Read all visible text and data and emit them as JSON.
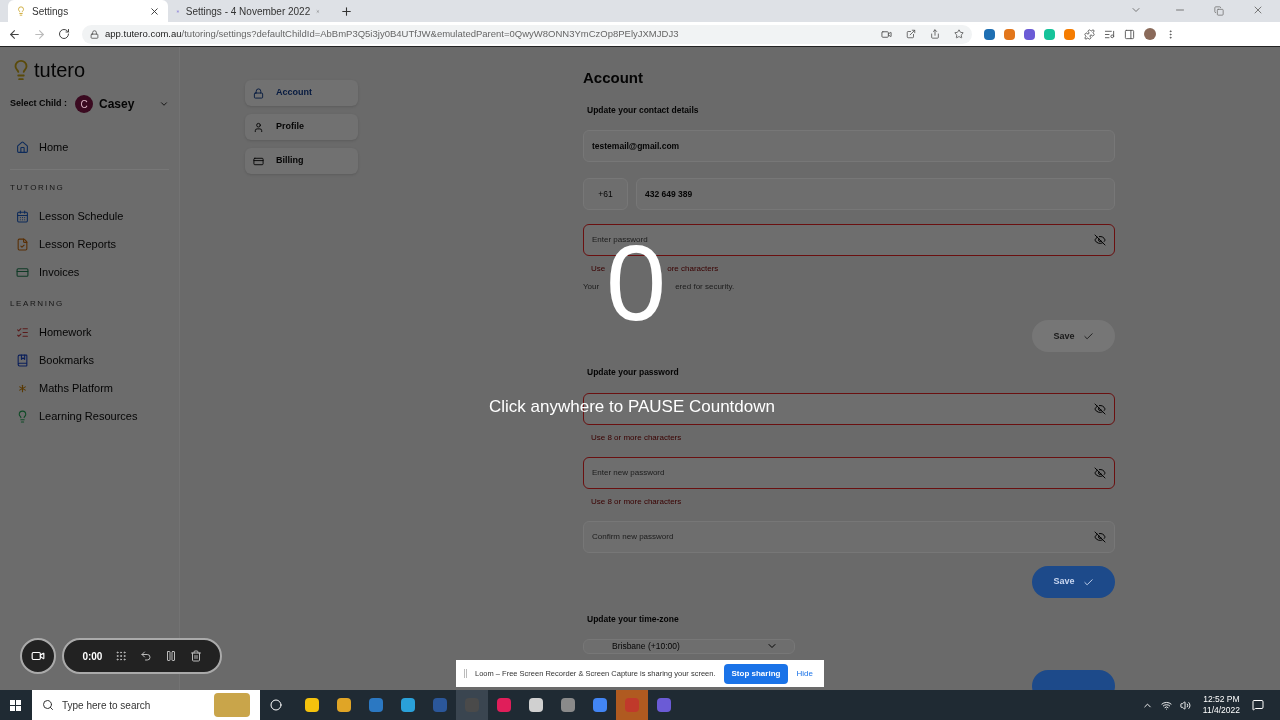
{
  "browser": {
    "tabs": [
      {
        "title": "Settings",
        "selected": true
      },
      {
        "title": "Settings - 4 November 2022",
        "selected": false
      }
    ],
    "url_host": "app.tutero.com.au",
    "url_path": "/tutoring/settings?defaultChildId=AbBmP3Q5i3jy0B4UTfJW&emulatedParent=0QwyW8ONN3YmCzOp8PElyJXMJDJ3"
  },
  "sidebar": {
    "logo": "tutero",
    "child_label": "Select Child :",
    "child_initial": "C",
    "child_name": "Casey",
    "sections": [
      {
        "items": [
          {
            "label": "Home"
          }
        ]
      },
      {
        "heading": "TUTORING",
        "items": [
          {
            "label": "Lesson Schedule"
          },
          {
            "label": "Lesson Reports"
          },
          {
            "label": "Invoices"
          }
        ]
      },
      {
        "heading": "LEARNING",
        "items": [
          {
            "label": "Homework"
          },
          {
            "label": "Bookmarks"
          },
          {
            "label": "Maths Platform"
          },
          {
            "label": "Learning Resources"
          }
        ]
      }
    ]
  },
  "settings_nav": [
    {
      "label": "Account",
      "selected": true
    },
    {
      "label": "Profile",
      "selected": false
    },
    {
      "label": "Billing",
      "selected": false
    }
  ],
  "account": {
    "title": "Account",
    "contact": {
      "heading": "Update your contact details",
      "email": "testemail@gmail.com",
      "country_code": "+61",
      "phone": "432 649 389",
      "password_placeholder": "Enter password",
      "password_hint": [
        "Use",
        "ore characters"
      ],
      "note": [
        "Your",
        "ered for security."
      ],
      "save": "Save",
      "save_disabled": true
    },
    "password": {
      "heading": "Update your password",
      "fields": [
        {
          "error": true,
          "hint": "Use 8 or more characters"
        },
        {
          "placeholder": "Enter new password",
          "error": true,
          "hint": "Use 8 or more characters"
        },
        {
          "placeholder": "Confirm new password",
          "error": false
        }
      ],
      "save": "Save",
      "save_disabled": false
    },
    "timezone": {
      "heading": "Update your time-zone",
      "value": "Brisbane (+10:00)"
    }
  },
  "countdown": {
    "number": "0",
    "message": "Click anywhere to PAUSE Countdown"
  },
  "recorder": {
    "time": "0:00"
  },
  "loom_banner": {
    "text": "Loom – Free Screen Recorder & Screen Capture is sharing your screen.",
    "stop": "Stop sharing",
    "hide": "Hide"
  },
  "taskbar": {
    "search_placeholder": "Type here to search",
    "time": "12:52 PM",
    "date": "11/4/2022"
  }
}
